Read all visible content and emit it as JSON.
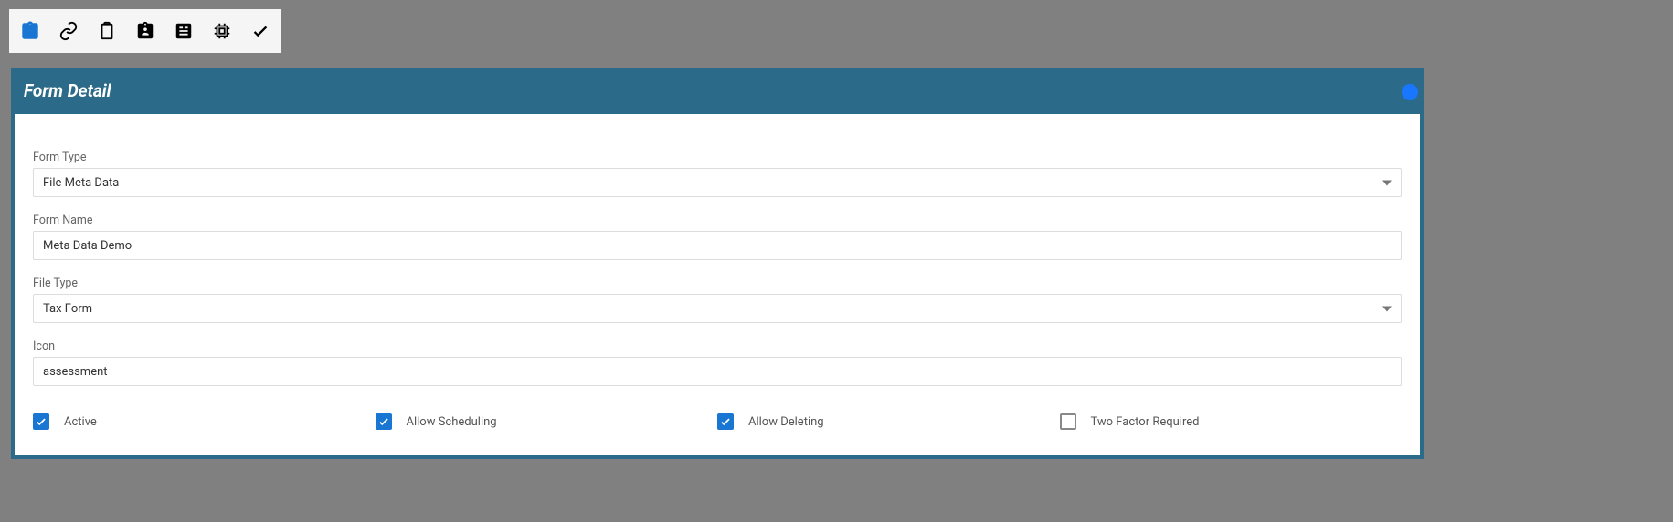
{
  "panel": {
    "title": "Form Detail"
  },
  "fields": {
    "form_type": {
      "label": "Form Type",
      "value": "File Meta Data"
    },
    "form_name": {
      "label": "Form Name",
      "value": "Meta Data Demo"
    },
    "file_type": {
      "label": "File Type",
      "value": "Tax Form"
    },
    "icon": {
      "label": "Icon",
      "value": "assessment"
    }
  },
  "checkboxes": {
    "active": {
      "label": "Active",
      "checked": true
    },
    "allow_scheduling": {
      "label": "Allow Scheduling",
      "checked": true
    },
    "allow_deleting": {
      "label": "Allow Deleting",
      "checked": true
    },
    "two_factor": {
      "label": "Two Factor Required",
      "checked": false
    }
  }
}
